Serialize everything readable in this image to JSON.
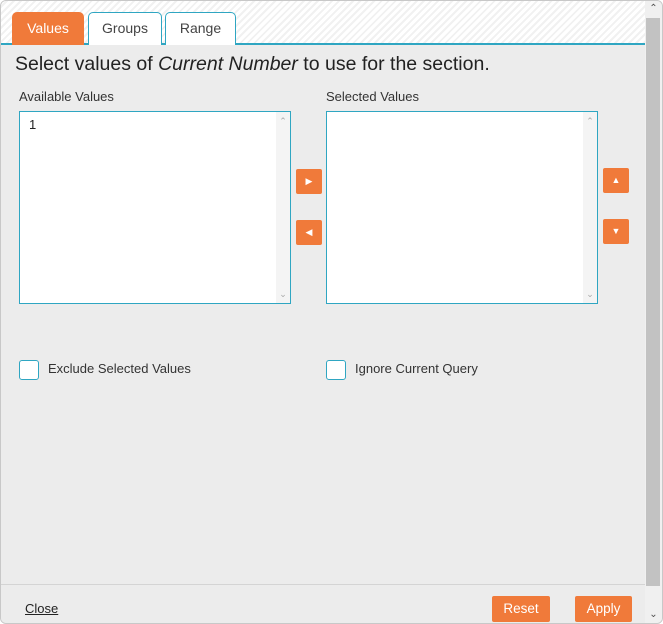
{
  "tabs": [
    {
      "label": "Values",
      "active": true
    },
    {
      "label": "Groups",
      "active": false
    },
    {
      "label": "Range",
      "active": false
    }
  ],
  "heading": {
    "prefix": "Select values of ",
    "field": "Current Number",
    "suffix": " to use for the section."
  },
  "available": {
    "label": "Available Values",
    "items": [
      "1"
    ]
  },
  "selected": {
    "label": "Selected Values",
    "items": []
  },
  "icons": {
    "move_right": "▶",
    "move_left": "◀",
    "move_up": "▲",
    "move_down": "▼",
    "scroll_up": "⌃",
    "scroll_down": "⌄"
  },
  "options": {
    "exclude_label": "Exclude Selected Values",
    "exclude_checked": false,
    "ignore_label": "Ignore Current Query",
    "ignore_checked": false
  },
  "footer": {
    "close_label": "Close",
    "reset_label": "Reset",
    "apply_label": "Apply"
  },
  "colors": {
    "accent": "#f07a3a",
    "border": "#2fa6c2"
  }
}
